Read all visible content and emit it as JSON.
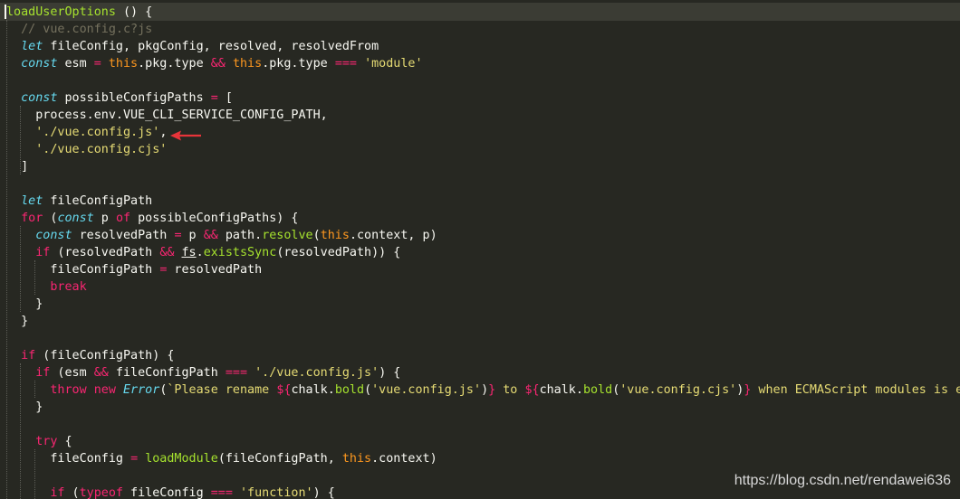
{
  "editor": {
    "lines": [
      [
        {
          "t": "loadUserOptions",
          "c": "fn"
        },
        {
          "t": " () {"
        }
      ],
      [
        {
          "t": "  "
        },
        {
          "t": "// vue.config.c?js",
          "c": "com"
        }
      ],
      [
        {
          "t": "  "
        },
        {
          "t": "let",
          "c": "kwi"
        },
        {
          "t": " fileConfig, pkgConfig, resolved, resolvedFrom"
        }
      ],
      [
        {
          "t": "  "
        },
        {
          "t": "const",
          "c": "kwi"
        },
        {
          "t": " esm "
        },
        {
          "t": "=",
          "c": "op"
        },
        {
          "t": " "
        },
        {
          "t": "this",
          "c": "th"
        },
        {
          "t": ".pkg.type "
        },
        {
          "t": "&&",
          "c": "op"
        },
        {
          "t": " "
        },
        {
          "t": "this",
          "c": "th"
        },
        {
          "t": ".pkg.type "
        },
        {
          "t": "===",
          "c": "op"
        },
        {
          "t": " "
        },
        {
          "t": "'module'",
          "c": "str"
        }
      ],
      [],
      [
        {
          "t": "  "
        },
        {
          "t": "const",
          "c": "kwi"
        },
        {
          "t": " possibleConfigPaths "
        },
        {
          "t": "=",
          "c": "op"
        },
        {
          "t": " ["
        }
      ],
      [
        {
          "t": "    process.env.VUE_CLI_SERVICE_CONFIG_PATH,"
        }
      ],
      [
        {
          "t": "    "
        },
        {
          "t": "'./vue.config.js'",
          "c": "str"
        },
        {
          "t": ","
        }
      ],
      [
        {
          "t": "    "
        },
        {
          "t": "'./vue.config.cjs'",
          "c": "str"
        }
      ],
      [
        {
          "t": "  ]"
        }
      ],
      [],
      [
        {
          "t": "  "
        },
        {
          "t": "let",
          "c": "kwi"
        },
        {
          "t": " fileConfigPath"
        }
      ],
      [
        {
          "t": "  "
        },
        {
          "t": "for",
          "c": "kw"
        },
        {
          "t": " ("
        },
        {
          "t": "const",
          "c": "kwi"
        },
        {
          "t": " p "
        },
        {
          "t": "of",
          "c": "kw"
        },
        {
          "t": " possibleConfigPaths) {"
        }
      ],
      [
        {
          "t": "    "
        },
        {
          "t": "const",
          "c": "kwi"
        },
        {
          "t": " resolvedPath "
        },
        {
          "t": "=",
          "c": "op"
        },
        {
          "t": " p "
        },
        {
          "t": "&&",
          "c": "op"
        },
        {
          "t": " path."
        },
        {
          "t": "resolve",
          "c": "fn"
        },
        {
          "t": "("
        },
        {
          "t": "this",
          "c": "th"
        },
        {
          "t": ".context, p)"
        }
      ],
      [
        {
          "t": "    "
        },
        {
          "t": "if",
          "c": "kw"
        },
        {
          "t": " (resolvedPath "
        },
        {
          "t": "&&",
          "c": "op"
        },
        {
          "t": " "
        },
        {
          "t": "fs",
          "c": "u"
        },
        {
          "t": "."
        },
        {
          "t": "existsSync",
          "c": "fn"
        },
        {
          "t": "(resolvedPath)) {"
        }
      ],
      [
        {
          "t": "      fileConfigPath "
        },
        {
          "t": "=",
          "c": "op"
        },
        {
          "t": " resolvedPath"
        }
      ],
      [
        {
          "t": "      "
        },
        {
          "t": "break",
          "c": "kw"
        }
      ],
      [
        {
          "t": "    }"
        }
      ],
      [
        {
          "t": "  }"
        }
      ],
      [],
      [
        {
          "t": "  "
        },
        {
          "t": "if",
          "c": "kw"
        },
        {
          "t": " (fileConfigPath) {"
        }
      ],
      [
        {
          "t": "    "
        },
        {
          "t": "if",
          "c": "kw"
        },
        {
          "t": " (esm "
        },
        {
          "t": "&&",
          "c": "op"
        },
        {
          "t": " fileConfigPath "
        },
        {
          "t": "===",
          "c": "op"
        },
        {
          "t": " "
        },
        {
          "t": "'./vue.config.js'",
          "c": "str"
        },
        {
          "t": ") {"
        }
      ],
      [
        {
          "t": "      "
        },
        {
          "t": "throw",
          "c": "kw"
        },
        {
          "t": " "
        },
        {
          "t": "new",
          "c": "kw"
        },
        {
          "t": " "
        },
        {
          "t": "Error",
          "c": "kwi"
        },
        {
          "t": "("
        },
        {
          "t": "`Please rename ",
          "c": "str"
        },
        {
          "t": "${",
          "c": "op"
        },
        {
          "t": "chalk."
        },
        {
          "t": "bold",
          "c": "fn"
        },
        {
          "t": "("
        },
        {
          "t": "'vue.config.js'",
          "c": "str"
        },
        {
          "t": ")"
        },
        {
          "t": "}",
          "c": "op"
        },
        {
          "t": " to ",
          "c": "str"
        },
        {
          "t": "${",
          "c": "op"
        },
        {
          "t": "chalk."
        },
        {
          "t": "bold",
          "c": "fn"
        },
        {
          "t": "("
        },
        {
          "t": "'vue.config.cjs'",
          "c": "str"
        },
        {
          "t": ")"
        },
        {
          "t": "}",
          "c": "op"
        },
        {
          "t": " when ECMAScript modules is enabled`",
          "c": "str"
        }
      ],
      [
        {
          "t": "    }"
        }
      ],
      [],
      [
        {
          "t": "    "
        },
        {
          "t": "try",
          "c": "kw"
        },
        {
          "t": " {"
        }
      ],
      [
        {
          "t": "      fileConfig "
        },
        {
          "t": "=",
          "c": "op"
        },
        {
          "t": " "
        },
        {
          "t": "loadModule",
          "c": "fn"
        },
        {
          "t": "(fileConfigPath, "
        },
        {
          "t": "this",
          "c": "th"
        },
        {
          "t": ".context)"
        }
      ],
      [],
      [
        {
          "t": "      "
        },
        {
          "t": "if",
          "c": "kw"
        },
        {
          "t": " ("
        },
        {
          "t": "typeof",
          "c": "kw"
        },
        {
          "t": " fileConfig "
        },
        {
          "t": "===",
          "c": "op"
        },
        {
          "t": " "
        },
        {
          "t": "'function'",
          "c": "str"
        },
        {
          "t": ") {"
        }
      ]
    ]
  },
  "colors": {
    "background": "#272822",
    "string": "#e6db74",
    "keyword": "#f92672",
    "function": "#a6e22e",
    "this": "#fd971f",
    "arrow": "#e8343a"
  },
  "annotation": {
    "icon": "red-arrow-icon"
  },
  "watermark": {
    "text": "https://blog.csdn.net/rendawei636"
  }
}
